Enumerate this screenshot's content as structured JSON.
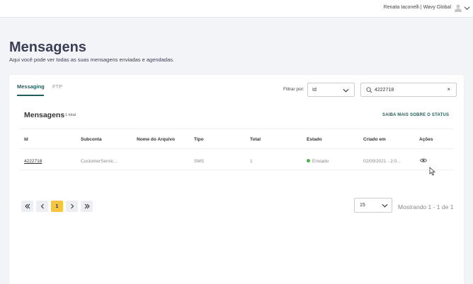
{
  "header": {
    "user_label": "Renata Iaconelli | Wavy Global"
  },
  "page": {
    "title": "Mensagens",
    "subtitle": "Aqui você pode ver todas as suas mensagens enviadas e agendadas."
  },
  "tabs": [
    {
      "label": "Messaging",
      "active": true
    },
    {
      "label": "FTP",
      "active": false
    }
  ],
  "filter": {
    "label": "Filtrar por:",
    "selected": "Id"
  },
  "search": {
    "value": "4222718",
    "clear_glyph": "×"
  },
  "section": {
    "title": "Mensagens",
    "total": "1 total",
    "status_link": "SAIBA MAIS SOBRE O STATUS"
  },
  "table": {
    "columns": [
      "Id",
      "Subconta",
      "Nome do Arquivo",
      "Tipo",
      "Total",
      "Estado",
      "Criado em",
      "Ações"
    ],
    "rows": [
      {
        "id": "4222718",
        "subconta": "CustomerServic...",
        "arquivo": "",
        "tipo": "SMS",
        "total": "1",
        "estado": "Enviado",
        "criado": "02/09/2021 - 2:0...",
        "acoes_icon": "eye-icon"
      }
    ]
  },
  "pagination": {
    "current_page": "1",
    "per_page": "15",
    "showing": "Mostrando 1 - 1 de 1"
  },
  "colors": {
    "accent": "#1f5f5b",
    "current_page": "#f5c542",
    "status_sent": "#4caf50",
    "title": "#3a3f55"
  }
}
